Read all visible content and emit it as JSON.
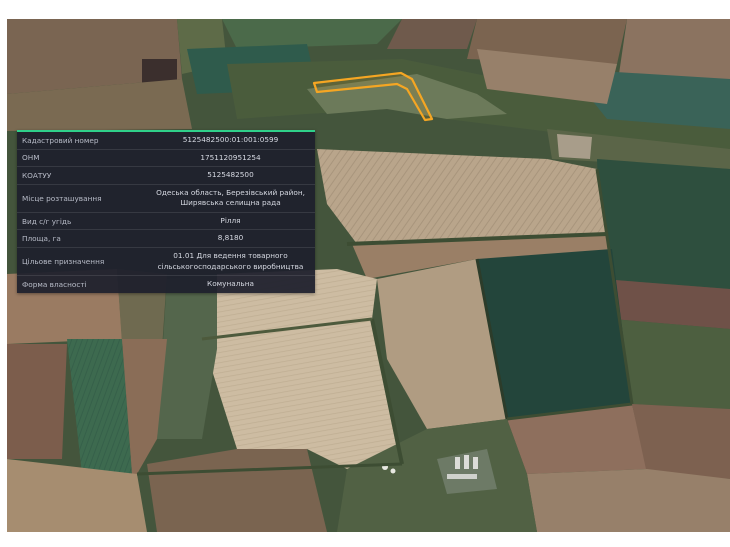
{
  "map": {
    "type": "satellite",
    "highlight_color": "#f5a623"
  },
  "info_panel": {
    "accent_color": "#2fd08a",
    "rows": [
      {
        "label": "Кадастровий номер",
        "value": "5125482500:01:001:0599"
      },
      {
        "label": "ОНМ",
        "value": "1751120951254"
      },
      {
        "label": "КОАТУУ",
        "value": "5125482500"
      },
      {
        "label": "Місце розташування",
        "value": "Одеська область, Березівський район,\nШирявська селищна рада"
      },
      {
        "label": "Вид с/г угідь",
        "value": "Рілля"
      },
      {
        "label": "Площа, га",
        "value": "8,8180"
      },
      {
        "label": "Цільове призначення",
        "value": "01.01 Для ведення товарного\nсільськогосподарського виробництва"
      },
      {
        "label": "Форма власності",
        "value": "Комунальна"
      }
    ]
  }
}
